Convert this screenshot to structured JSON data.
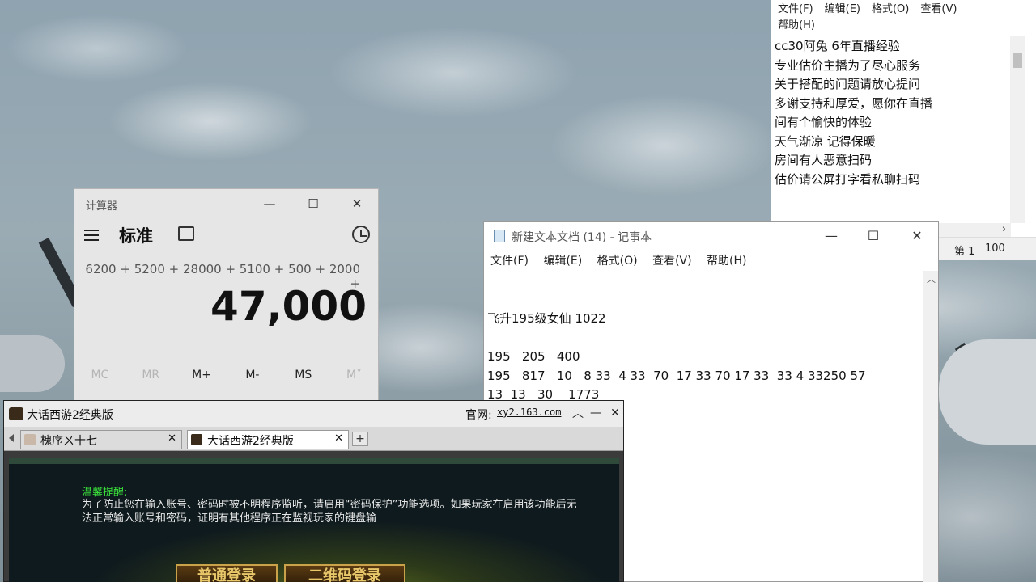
{
  "colors": {
    "game_notice_title": "#3ce83c",
    "game_button_text": "#e8c66a",
    "game_button_border": "#c9a24a"
  },
  "notepad_top": {
    "menu": [
      "文件(F)",
      "编辑(E)",
      "格式(O)",
      "查看(V)",
      "帮助(H)"
    ],
    "lines": [
      "cc30阿兔 6年直播经验",
      "专业估价主播为了尽心服务",
      "关于搭配的问题请放心提问",
      "多谢支持和厚爱，愿你在直播",
      "间有个愉快的体验",
      "天气渐凉 记得保暖",
      "房间有人恶意扫码",
      "估价请公屏打字看私聊扫码"
    ],
    "status": {
      "line": "第 1",
      "zoom": "100"
    }
  },
  "calculator": {
    "title": "计算器",
    "mode": "标准",
    "expression": "6200 + 5200 + 28000 + 5100 + 500 + 2000 +",
    "result": "47,000",
    "memory_buttons": [
      "MC",
      "MR",
      "M+",
      "M-",
      "MS",
      "M˅"
    ]
  },
  "notepad_main": {
    "title": "新建文本文档 (14) - 记事本",
    "menu": [
      "文件(F)",
      "编辑(E)",
      "格式(O)",
      "查看(V)",
      "帮助(H)"
    ],
    "text": "飞升195级女仙 1022\n\n195   205   400\n195   817   10   8 33  4 33  70  17 33 70 17 33  33 4 33250 57\n13  13   30    1773"
  },
  "game": {
    "title": "大话西游2经典版",
    "site_label": "官网:",
    "site_url": "xy2.163.com",
    "tabs": [
      {
        "label": "槐序ㄨ十七"
      },
      {
        "label": "大话西游2经典版"
      }
    ],
    "notice_title": "温馨提醒:",
    "notice_body": "为了防止您在输入账号、密码时被不明程序监听，请启用“密码保护”功能选项。如果玩家在启用该功能后无法正常输入账号和密码，证明有其他程序正在监视玩家的键盘输",
    "buttons": [
      "普通登录",
      "二维码登录"
    ]
  }
}
